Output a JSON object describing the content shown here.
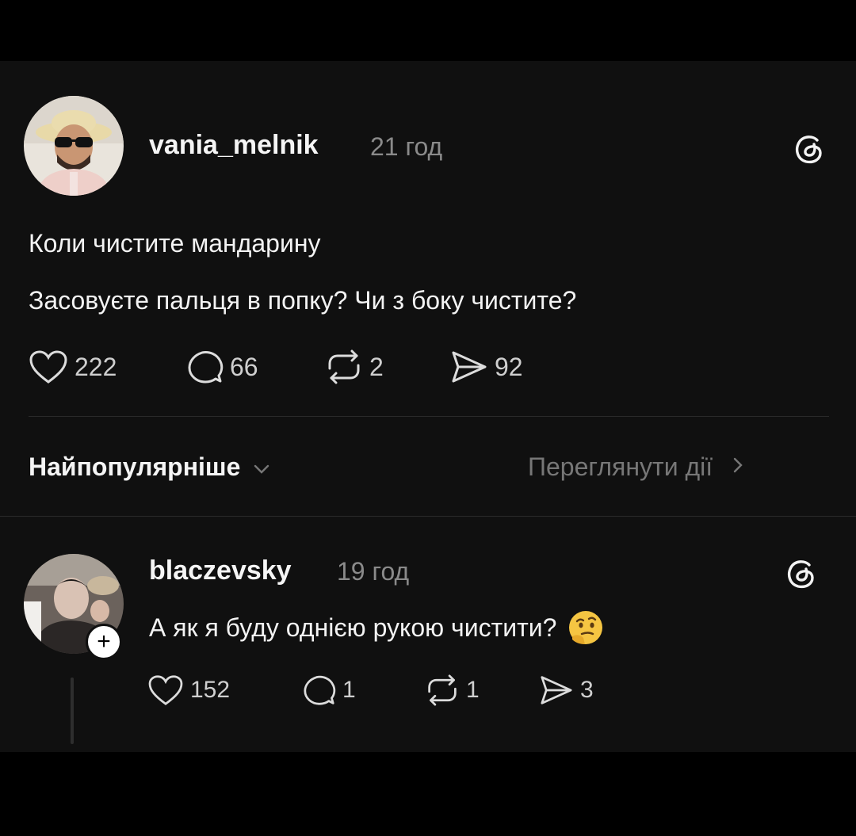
{
  "post": {
    "username": "vania_melnik",
    "time": "21 год",
    "lines": [
      "Коли чистите мандарину",
      "Засовуєте пальця в попку? Чи з боку чистите?"
    ],
    "likes": "222",
    "comments": "66",
    "reposts": "2",
    "shares": "92"
  },
  "sort": {
    "label": "Найпопулярніше",
    "view_activity": "Переглянути дії"
  },
  "reply": {
    "username": "blaczevsky",
    "time": "19 год",
    "text": "А як я буду однією рукою чистити?",
    "emoji": "🤔",
    "likes": "152",
    "comments": "1",
    "reposts": "1",
    "shares": "3"
  },
  "colors": {
    "background": "#000000",
    "card": "#101010",
    "text": "#f3f3f3",
    "muted": "#8a8a8a"
  },
  "icons": [
    "threads-icon",
    "heart-icon",
    "comment-icon",
    "repost-icon",
    "share-icon",
    "chevron-down-icon",
    "chevron-right-icon",
    "plus-icon",
    "thinking-face-emoji"
  ]
}
